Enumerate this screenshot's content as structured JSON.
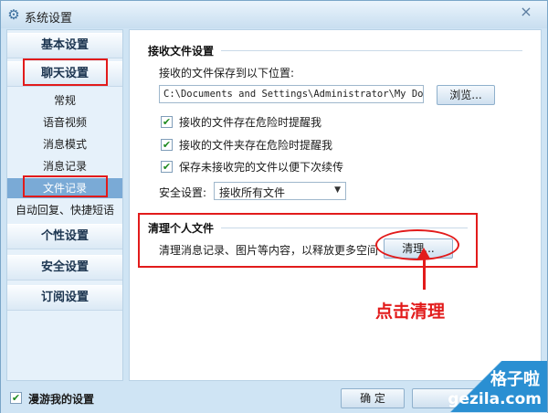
{
  "window": {
    "title": "系统设置",
    "close": "×"
  },
  "sidebar": {
    "categories": [
      {
        "label": "基本设置"
      },
      {
        "label": "聊天设置"
      },
      {
        "label": "个性设置"
      },
      {
        "label": "安全设置"
      },
      {
        "label": "订阅设置"
      }
    ],
    "sub_items": [
      {
        "label": "常规"
      },
      {
        "label": "语音视频"
      },
      {
        "label": "消息模式"
      },
      {
        "label": "消息记录"
      },
      {
        "label": "文件记录",
        "active": true
      },
      {
        "label": "自动回复、快捷短语"
      }
    ]
  },
  "receive": {
    "title": "接收文件设置",
    "save_label": "接收的文件保存到以下位置:",
    "path": "C:\\Documents and Settings\\Administrator\\My Documents",
    "browse": "浏览...",
    "options": [
      {
        "label": "接收的文件存在危险时提醒我",
        "checked": true
      },
      {
        "label": "接收的文件夹存在危险时提醒我",
        "checked": true
      },
      {
        "label": "保存未接收完的文件以便下次续传",
        "checked": true
      }
    ],
    "security_label": "安全设置:",
    "security_value": "接收所有文件"
  },
  "cleanup": {
    "title": "清理个人文件",
    "description": "清理消息记录、图片等内容，以释放更多空间",
    "button": "清理..."
  },
  "annotation": {
    "text": "点击清理"
  },
  "footer": {
    "roam_label": "漫游我的设置",
    "roam_checked": true,
    "ok": "确 定"
  },
  "watermark": {
    "line1": "格子啦",
    "line2": "gezila.com"
  },
  "colors": {
    "accent": "#7aaad6",
    "annotation": "#e21b1b",
    "window_bg": "#cfe4f4"
  }
}
